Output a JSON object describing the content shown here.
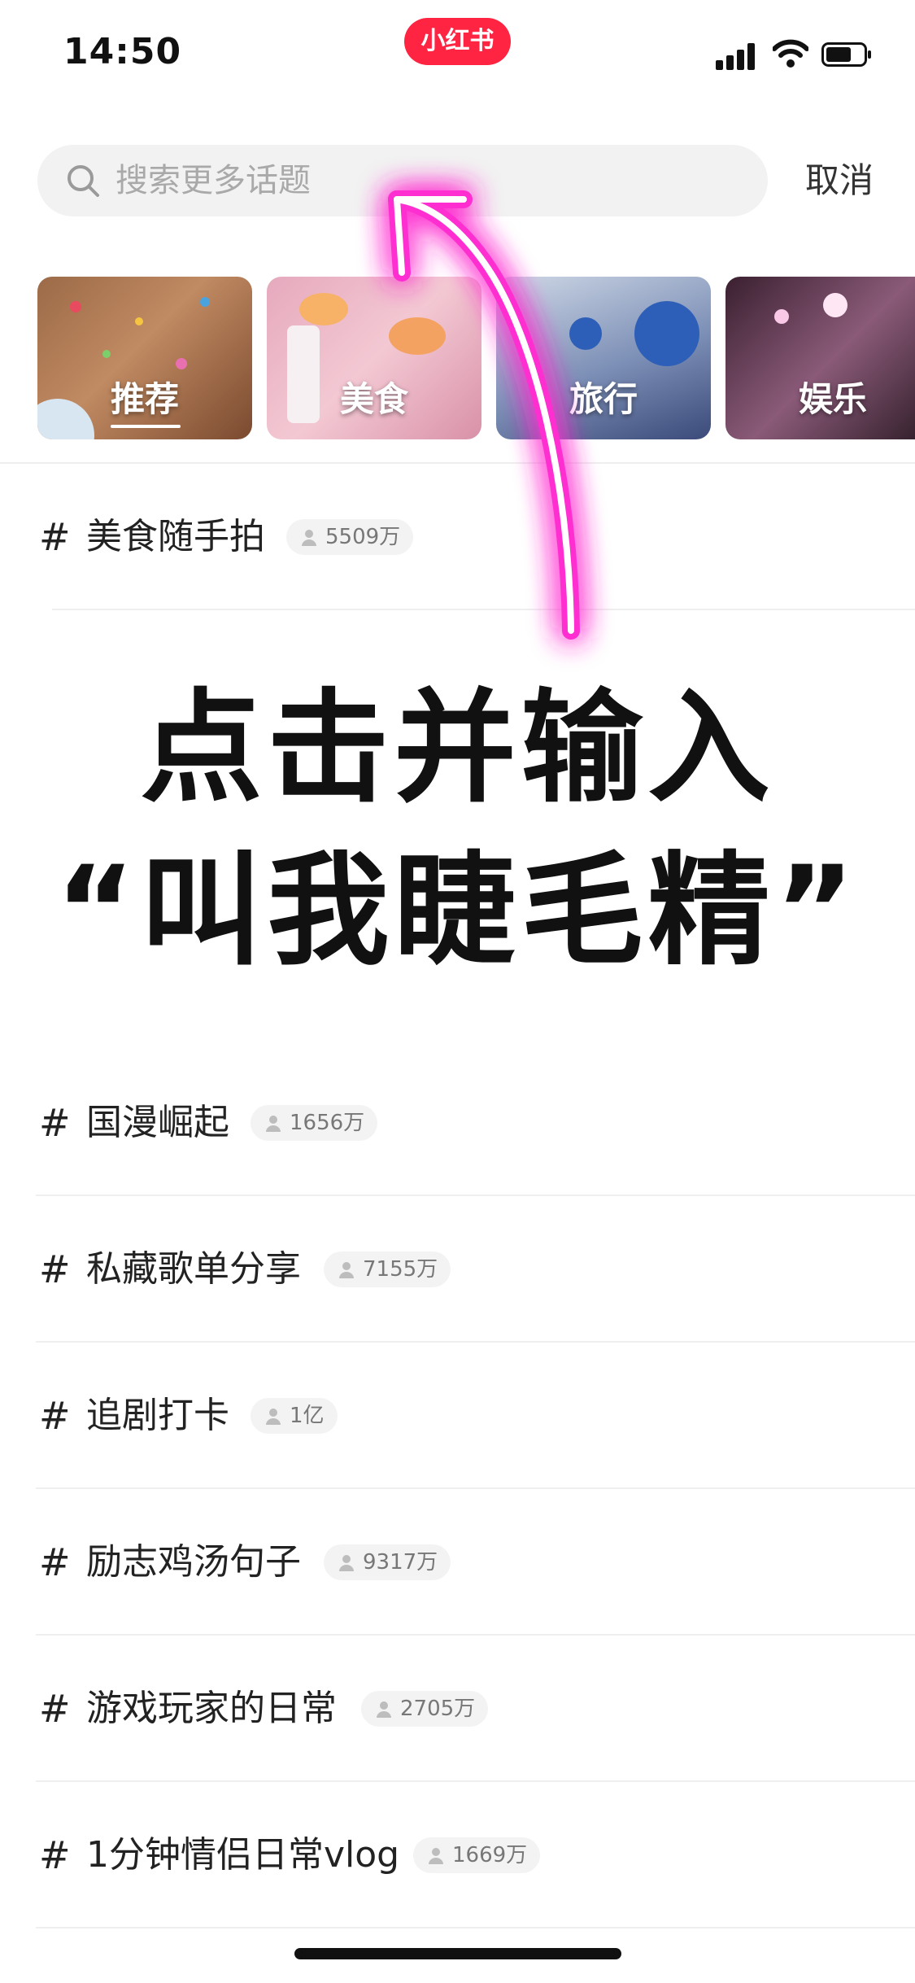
{
  "status_bar": {
    "time": "14:50",
    "app_badge": "小红书"
  },
  "search": {
    "placeholder": "搜索更多话题",
    "cancel_label": "取消"
  },
  "categories": [
    {
      "label": "推荐",
      "selected": true
    },
    {
      "label": "美食",
      "selected": false
    },
    {
      "label": "旅行",
      "selected": false
    },
    {
      "label": "娱乐",
      "selected": false
    }
  ],
  "overlay": {
    "line1": "点击并输入",
    "line2": "“叫我睫毛精”"
  },
  "topics": [
    {
      "hash": "#",
      "name": "美食随手拍",
      "count": "5509万"
    },
    {
      "hash": "#",
      "name": "国漫崛起",
      "count": "1656万"
    },
    {
      "hash": "#",
      "name": "私藏歌单分享",
      "count": "7155万"
    },
    {
      "hash": "#",
      "name": "追剧打卡",
      "count": "1亿"
    },
    {
      "hash": "#",
      "name": "励志鸡汤句子",
      "count": "9317万"
    },
    {
      "hash": "#",
      "name": "游戏玩家的日常",
      "count": "2705万"
    },
    {
      "hash": "#",
      "name": "1分钟情侣日常vlog",
      "count": "1669万"
    }
  ],
  "colors": {
    "brand": "#ff2442",
    "arrow_glow": "#ff2fd0"
  }
}
